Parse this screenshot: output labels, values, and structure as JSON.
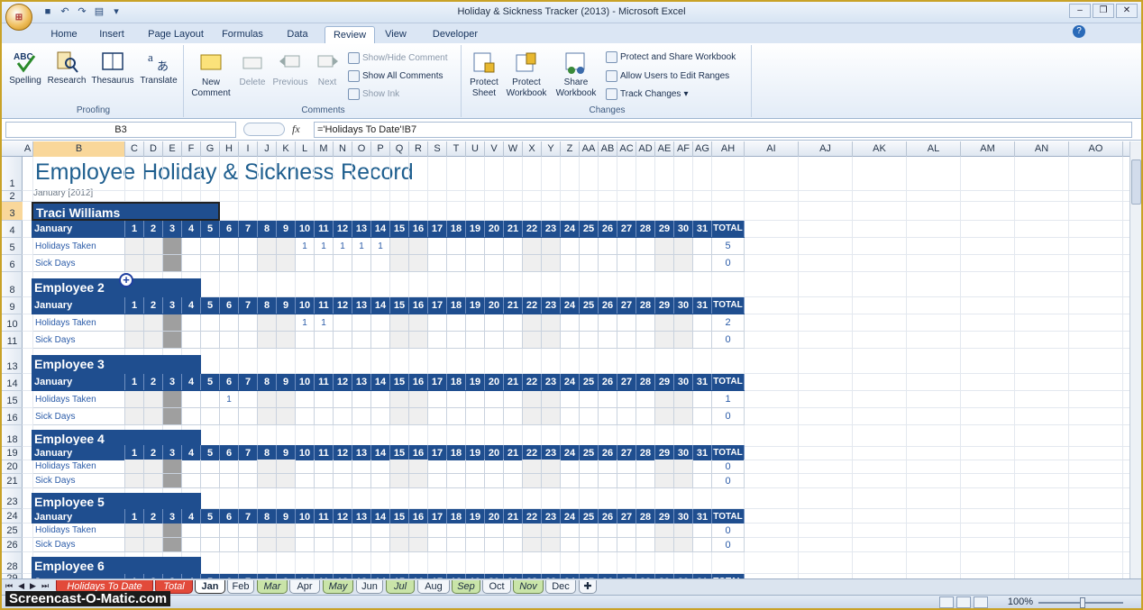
{
  "window": {
    "title": "Holiday & Sickness Tracker (2013) - Microsoft Excel",
    "controls": [
      "–",
      "❐",
      "✕"
    ]
  },
  "ribbon_tabs": [
    "Home",
    "Insert",
    "Page Layout",
    "Formulas",
    "Data",
    "Review",
    "View",
    "Developer"
  ],
  "active_tab": "Review",
  "ribbon": {
    "proofing": {
      "name": "Proofing",
      "buttons": [
        "Spelling",
        "Research",
        "Thesaurus",
        "Translate"
      ]
    },
    "comments": {
      "name": "Comments",
      "new_comment": "New Comment",
      "delete": "Delete",
      "previous": "Previous",
      "next": "Next",
      "show_hide": "Show/Hide Comment",
      "show_all": "Show All Comments",
      "show_ink": "Show Ink"
    },
    "changes": {
      "name": "Changes",
      "protect_sheet": "Protect Sheet",
      "protect_workbook": "Protect Workbook",
      "share_workbook": "Share Workbook",
      "protect_share": "Protect and Share Workbook",
      "allow_users": "Allow Users to Edit Ranges",
      "track_changes": "Track Changes"
    }
  },
  "formula_bar": {
    "name_box": "B3",
    "fx": "fx",
    "formula": "='Holidays To Date'!B7"
  },
  "columns": [
    "A",
    "B",
    "C",
    "D",
    "E",
    "F",
    "G",
    "H",
    "I",
    "J",
    "K",
    "L",
    "M",
    "N",
    "O",
    "P",
    "Q",
    "R",
    "S",
    "T",
    "U",
    "V",
    "W",
    "X",
    "Y",
    "Z",
    "AA",
    "AB",
    "AC",
    "AD",
    "AE",
    "AF",
    "AG",
    "AH",
    "AI",
    "AJ",
    "AK",
    "AL",
    "AM",
    "AN",
    "AO"
  ],
  "rows": [
    "1",
    "2",
    "3",
    "4",
    "5",
    "6",
    "8",
    "9",
    "10",
    "11",
    "13",
    "14",
    "15",
    "16",
    "18",
    "19",
    "20",
    "21",
    "23",
    "24",
    "25",
    "26",
    "28",
    "29"
  ],
  "sheet": {
    "title": "Employee Holiday & Sickness Record",
    "subtitle": "January [2012]",
    "month_label": "January",
    "total_label": "TOTAL",
    "days": [
      "1",
      "2",
      "3",
      "4",
      "5",
      "6",
      "7",
      "8",
      "9",
      "10",
      "11",
      "12",
      "13",
      "14",
      "15",
      "16",
      "17",
      "18",
      "19",
      "20",
      "21",
      "22",
      "23",
      "24",
      "25",
      "26",
      "27",
      "28",
      "29",
      "30",
      "31"
    ],
    "row_labels": {
      "holidays": "Holidays Taken",
      "sick": "Sick Days"
    },
    "employees": [
      {
        "name": "Traci Williams",
        "holidays": {
          "10": "1",
          "11": "1",
          "12": "1",
          "13": "1",
          "14": "1"
        },
        "holidays_total": "5",
        "sick_total": "0"
      },
      {
        "name": "Employee 2",
        "holidays": {
          "10": "1",
          "11": "1"
        },
        "holidays_total": "2",
        "sick_total": "0"
      },
      {
        "name": "Employee 3",
        "holidays": {
          "6": "1"
        },
        "holidays_total": "1",
        "sick_total": "0"
      },
      {
        "name": "Employee 4",
        "holidays": {},
        "holidays_total": "0",
        "sick_total": "0"
      },
      {
        "name": "Employee 5",
        "holidays": {},
        "holidays_total": "0",
        "sick_total": "0"
      },
      {
        "name": "Employee 6",
        "holidays": {},
        "holidays_total": "",
        "sick_total": ""
      }
    ]
  },
  "sheet_tabs": [
    {
      "label": "Holidays To Date",
      "style": "red"
    },
    {
      "label": "Total",
      "style": "red"
    },
    {
      "label": "Jan",
      "style": "active"
    },
    {
      "label": "Feb",
      "style": "plain"
    },
    {
      "label": "Mar",
      "style": "green"
    },
    {
      "label": "Apr",
      "style": "plain"
    },
    {
      "label": "May",
      "style": "green"
    },
    {
      "label": "Jun",
      "style": "plain"
    },
    {
      "label": "Jul",
      "style": "green"
    },
    {
      "label": "Aug",
      "style": "plain"
    },
    {
      "label": "Sep",
      "style": "green"
    },
    {
      "label": "Oct",
      "style": "plain"
    },
    {
      "label": "Nov",
      "style": "green"
    },
    {
      "label": "Dec",
      "style": "plain"
    }
  ],
  "status": {
    "zoom": "100%"
  },
  "watermark": "Screencast-O-Matic.com",
  "colors": {
    "header_blue": "#1f4e8f",
    "title_blue": "#1f5f8f",
    "weekend_gray": "#efefef",
    "holiday_gray": "#9f9f9f"
  }
}
